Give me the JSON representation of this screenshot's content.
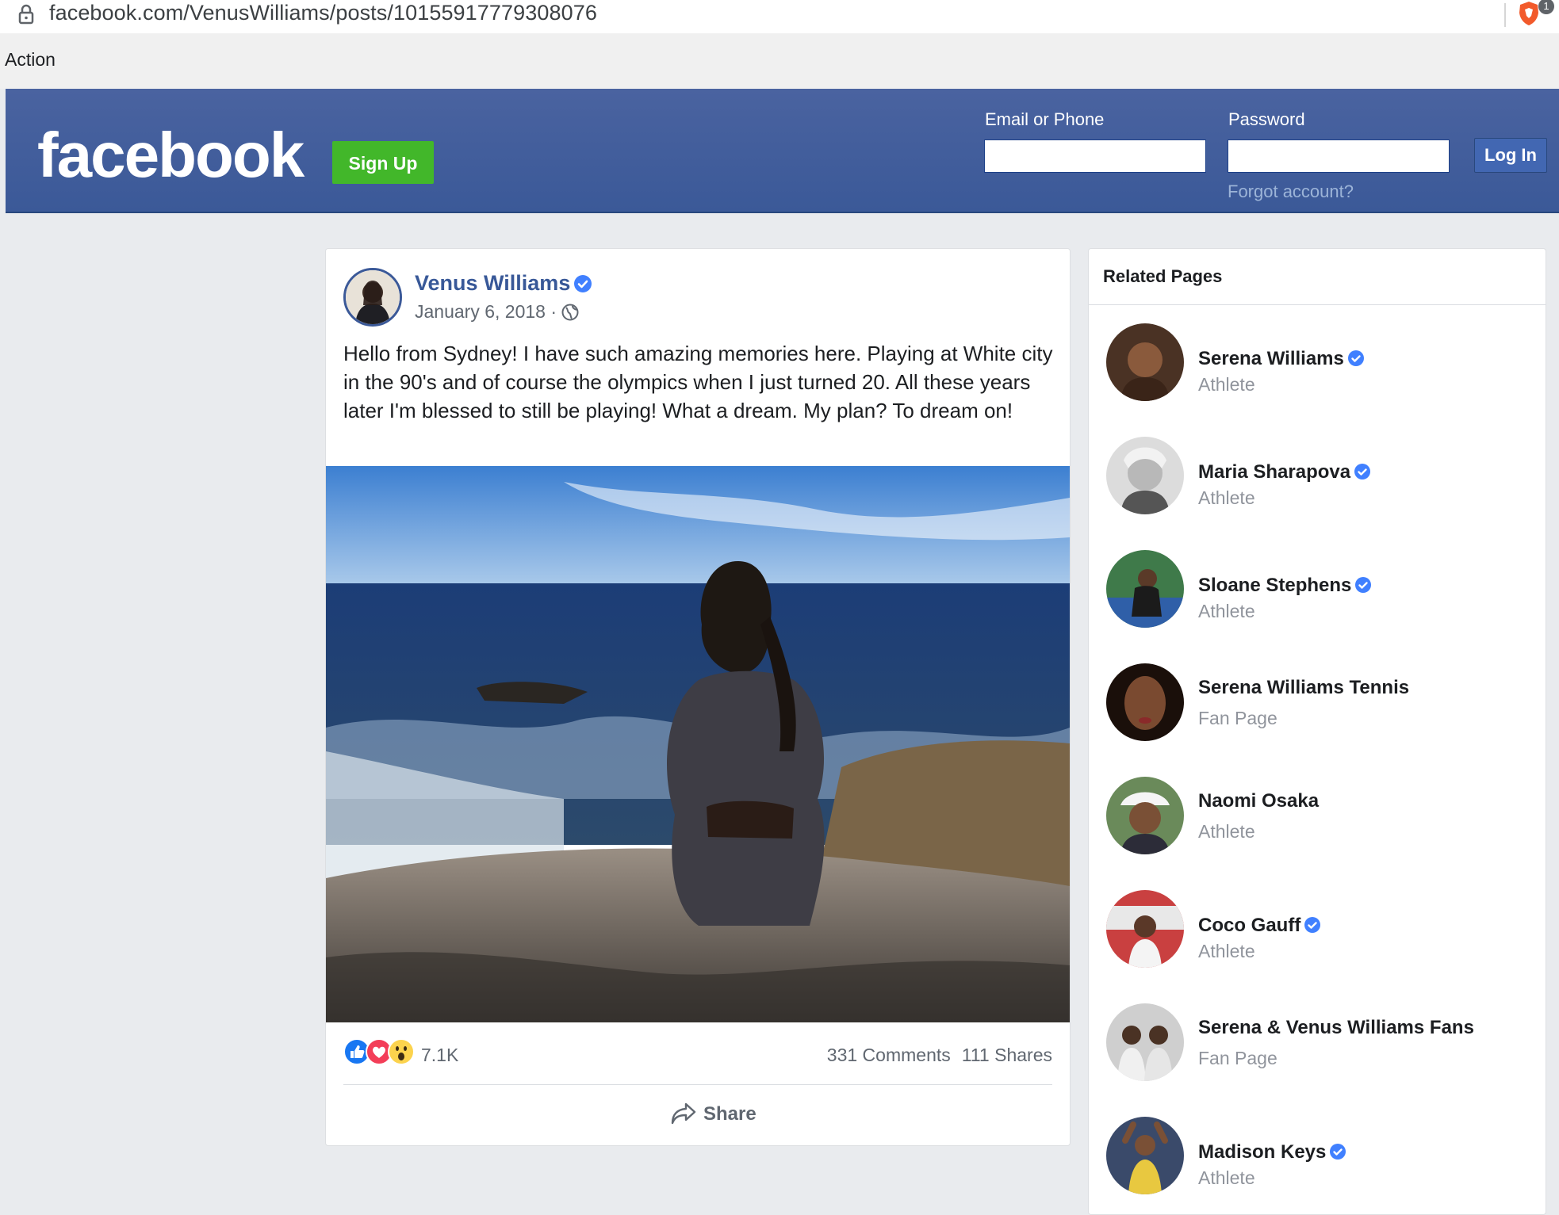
{
  "browser": {
    "url": "facebook.com/VenusWilliams/posts/10155917779308076",
    "badge_count": "1"
  },
  "action_bar": {
    "label": "Action"
  },
  "header": {
    "logo": "facebook",
    "signup_label": "Sign Up",
    "email_label": "Email or Phone",
    "password_label": "Password",
    "login_label": "Log In",
    "forgot_label": "Forgot account?"
  },
  "post": {
    "author": "Venus Williams",
    "date": "January 6, 2018 ·",
    "text": "Hello from Sydney! I have such amazing memories here. Playing at White city in the 90's and of course the olympics when I just turned 20. All these years later I'm blessed to still be playing! What a dream. My plan? To dream on!",
    "reaction_count": "7.1K",
    "reactions": [
      "like-icon",
      "love-icon",
      "wow-icon"
    ],
    "comments": "331 Comments",
    "shares": "111 Shares",
    "share_label": "Share"
  },
  "related": {
    "title": "Related Pages",
    "items": [
      {
        "name": "Serena Williams",
        "category": "Athlete",
        "verified": true
      },
      {
        "name": "Maria Sharapova",
        "category": "Athlete",
        "verified": true
      },
      {
        "name": "Sloane Stephens",
        "category": "Athlete",
        "verified": true
      },
      {
        "name": "Serena Williams Tennis",
        "category": "Fan Page",
        "verified": false
      },
      {
        "name": "Naomi Osaka",
        "category": "Athlete",
        "verified": false
      },
      {
        "name": "Coco Gauff",
        "category": "Athlete",
        "verified": true
      },
      {
        "name": "Serena & Venus Williams Fans",
        "category": "Fan Page",
        "verified": false
      },
      {
        "name": "Madison Keys",
        "category": "Athlete",
        "verified": true
      }
    ]
  },
  "colors": {
    "fb_blue": "#3b5998",
    "signup_green": "#42b72a",
    "link_blue": "#385898",
    "verified_blue": "#4080ff"
  }
}
